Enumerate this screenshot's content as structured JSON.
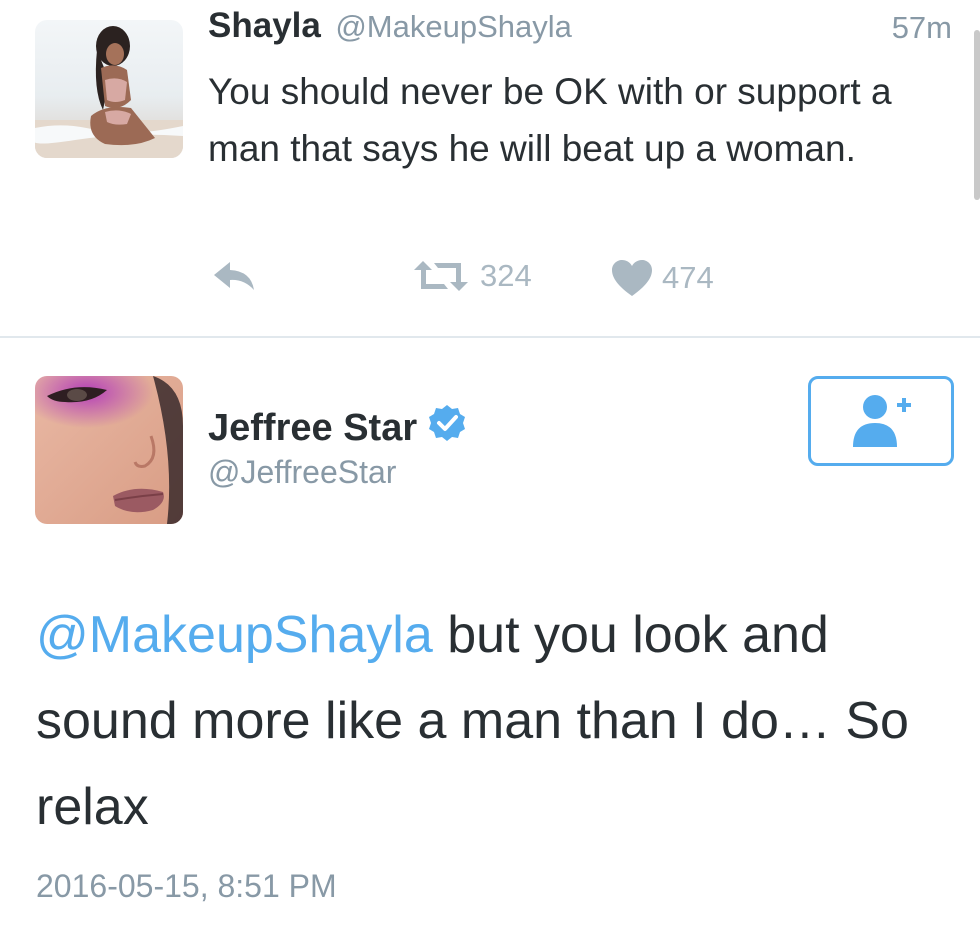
{
  "tweet1": {
    "name": "Shayla",
    "handle": "@MakeupShayla",
    "time": "57m",
    "text": "You should never be OK with or support a man that says he will beat up a woman.",
    "retweet_count": "324",
    "like_count": "474",
    "icons": {
      "reply": "reply-icon",
      "retweet": "retweet-icon",
      "like": "heart-icon"
    }
  },
  "tweet2": {
    "name": "Jeffree Star",
    "handle": "@JeffreeStar",
    "mention": "@MakeupShayla",
    "text": " but you look and sound more like a man than I do… So relax",
    "timestamp": "2016-05-15, 8:51 PM",
    "verified_icon": "verified-badge-icon",
    "follow_icon": "add-user-icon"
  },
  "colors": {
    "link": "#55acee",
    "muted": "#8899a6",
    "action": "#aab8c2",
    "text": "#292f33",
    "divider": "#e1e8ed"
  }
}
